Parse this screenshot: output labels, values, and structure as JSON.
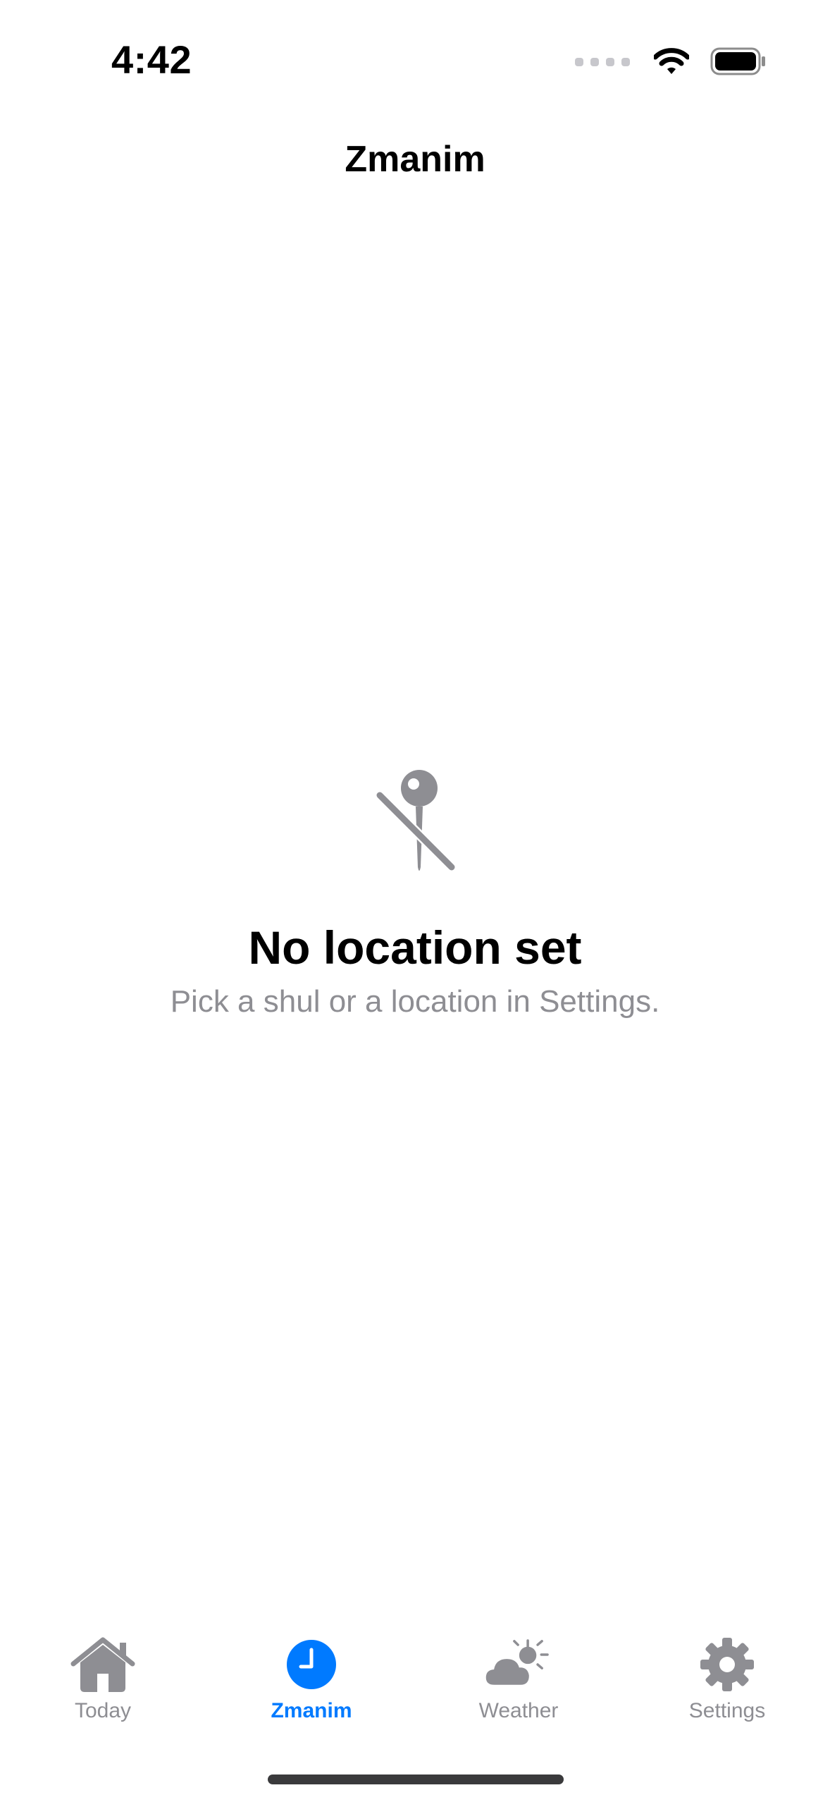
{
  "status_bar": {
    "time": "4:42"
  },
  "nav": {
    "title": "Zmanim"
  },
  "empty_state": {
    "icon": "location-slash-icon",
    "title": "No location set",
    "subtitle": "Pick a shul or a location in Settings."
  },
  "tabbar": {
    "active_color": "#007aff",
    "inactive_color": "#8e8e93",
    "tabs": [
      {
        "label": "Today",
        "icon": "house-icon",
        "active": false
      },
      {
        "label": "Zmanim",
        "icon": "clock-icon",
        "active": true
      },
      {
        "label": "Weather",
        "icon": "cloud-sun-icon",
        "active": false
      },
      {
        "label": "Settings",
        "icon": "gear-icon",
        "active": false
      }
    ]
  }
}
